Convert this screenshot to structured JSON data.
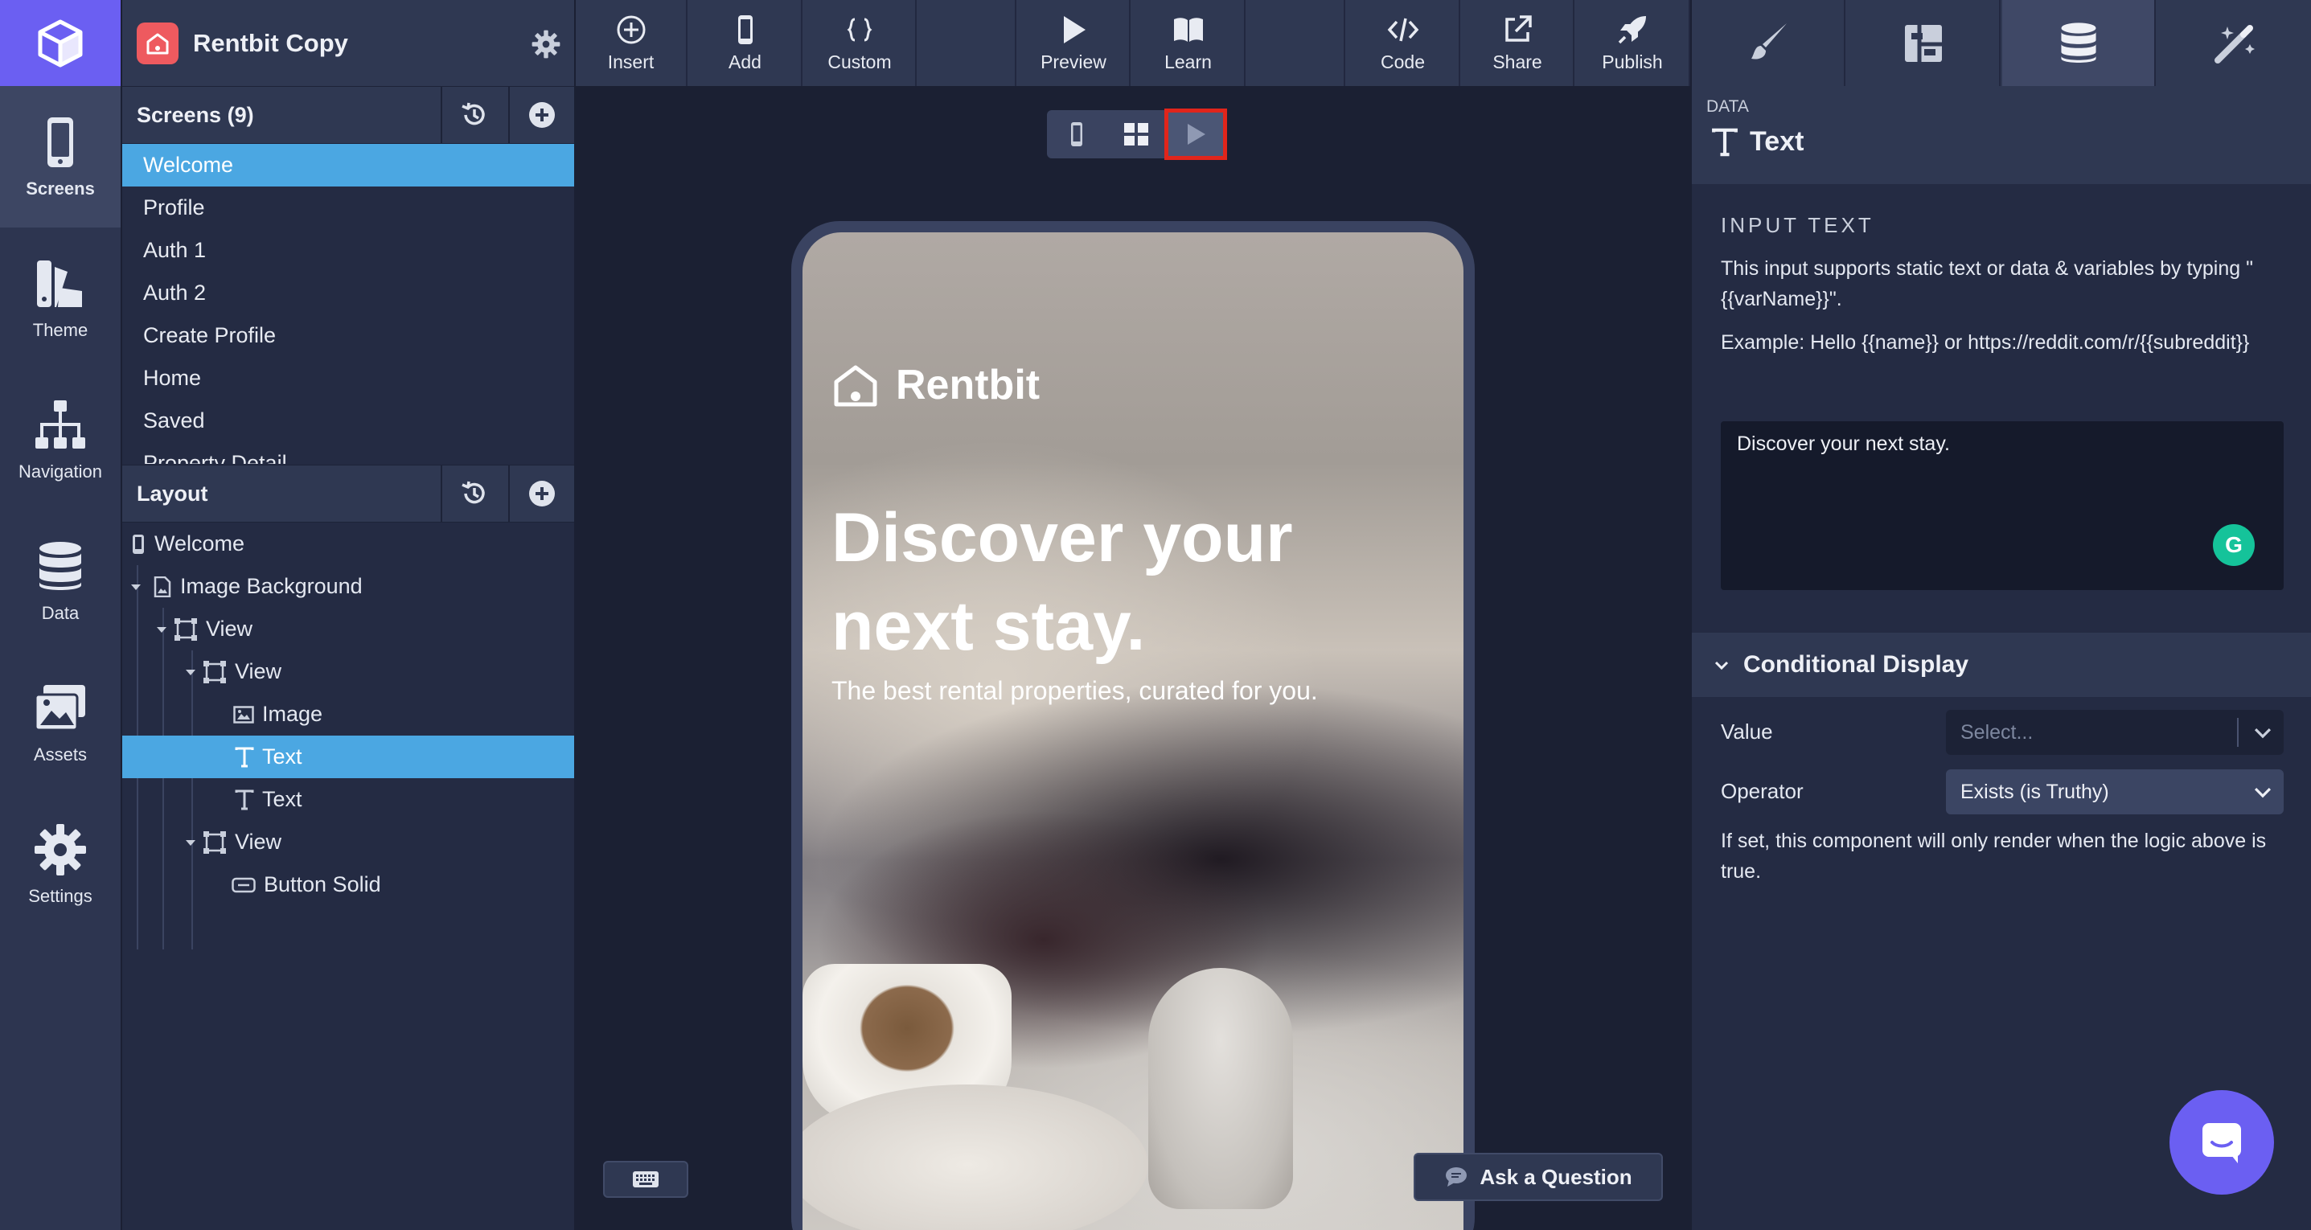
{
  "rail": {
    "items": [
      {
        "label": "Screens",
        "icon": "phone-icon"
      },
      {
        "label": "Theme",
        "icon": "palette-icon"
      },
      {
        "label": "Navigation",
        "icon": "sitemap-icon"
      },
      {
        "label": "Data",
        "icon": "database-icon"
      },
      {
        "label": "Assets",
        "icon": "images-icon"
      },
      {
        "label": "Settings",
        "icon": "gear-icon"
      }
    ]
  },
  "project": {
    "name": "Rentbit Copy"
  },
  "screens": {
    "title": "Screens (9)",
    "items": [
      "Welcome",
      "Profile",
      "Auth 1",
      "Auth 2",
      "Create Profile",
      "Home",
      "Saved",
      "Property Detail"
    ]
  },
  "layout": {
    "title": "Layout",
    "nodes": [
      "Welcome",
      "Image Background",
      "View",
      "View",
      "Image",
      "Text",
      "Text",
      "View",
      "Button Solid"
    ]
  },
  "toolbar": {
    "insert": "Insert",
    "add": "Add",
    "custom": "Custom",
    "preview": "Preview",
    "learn": "Learn",
    "code": "Code",
    "share": "Share",
    "publish": "Publish"
  },
  "preview": {
    "brand": "Rentbit",
    "headline": "Discover your next stay.",
    "subhead": "The best rental properties, curated for you."
  },
  "ask_question": "Ask a Question",
  "props": {
    "category": "DATA",
    "title": "Text",
    "input_section": "INPUT TEXT",
    "help1": "This input supports static text or data & variables by typing \"{{varName}}\".",
    "help2": "Example: Hello {{name}} or https://reddit.com/r/{{subreddit}}",
    "input_value": "Discover your next stay.",
    "grammarly_letter": "G",
    "conditional": {
      "title": "Conditional Display",
      "value_label": "Value",
      "value_placeholder": "Select...",
      "operator_label": "Operator",
      "operator_value": "Exists (is Truthy)",
      "help": "If set, this component will only render when the logic above is true."
    }
  },
  "colors": {
    "accent": "#6b5ff2",
    "selection": "#4ba7e2",
    "highlight": "#e1251b",
    "brand": "#ee5a5f"
  }
}
